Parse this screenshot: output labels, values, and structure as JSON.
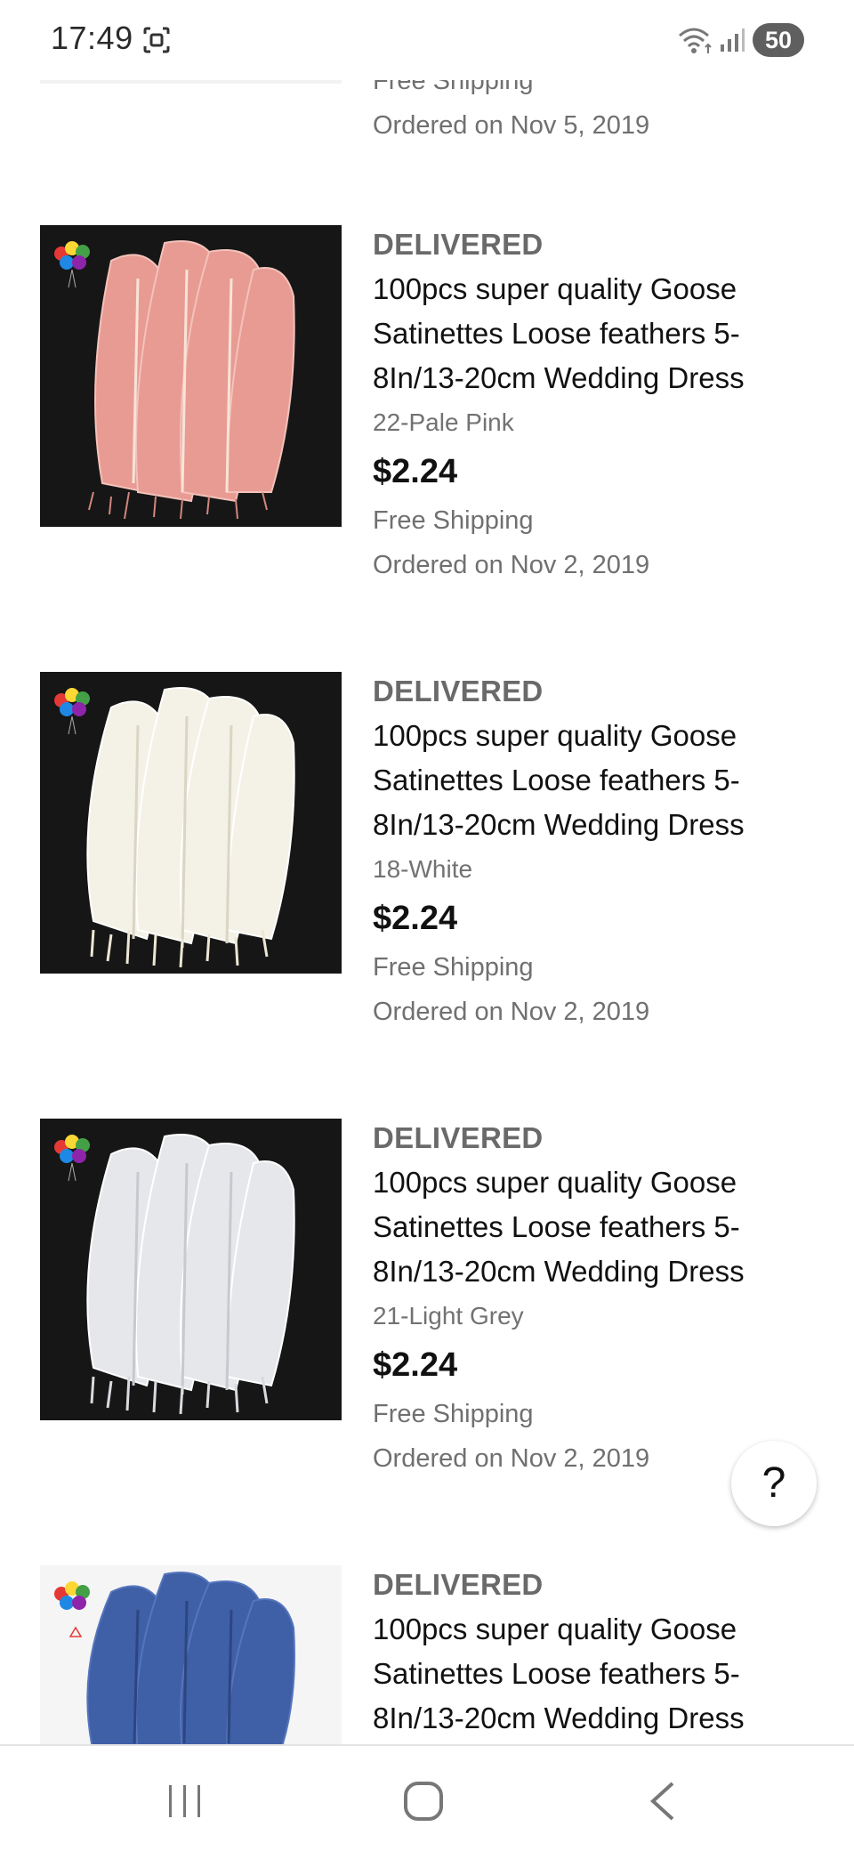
{
  "status_bar": {
    "time": "17:49",
    "battery": "50",
    "icons": [
      "screenshot-icon",
      "wifi-icon",
      "signal-icon"
    ]
  },
  "orders": [
    {
      "shipping": "Free Shipping",
      "ordered": "Ordered on Nov 5, 2019"
    },
    {
      "status": "DELIVERED",
      "title": "100pcs super quality Goose Satinettes Loose feathers 5-8In/13-20cm Wedding Dress",
      "variant": "22-Pale Pink",
      "price": "$2.24",
      "shipping": "Free Shipping",
      "ordered": "Ordered on Nov 2, 2019",
      "feather_color": "#e89b93"
    },
    {
      "status": "DELIVERED",
      "title": "100pcs super quality Goose Satinettes Loose feathers 5-8In/13-20cm Wedding Dress",
      "variant": "18-White",
      "price": "$2.24",
      "shipping": "Free Shipping",
      "ordered": "Ordered on Nov 2, 2019",
      "feather_color": "#f4f1e6"
    },
    {
      "status": "DELIVERED",
      "title": "100pcs super quality Goose Satinettes Loose feathers 5-8In/13-20cm Wedding Dress",
      "variant": "21-Light Grey",
      "price": "$2.24",
      "shipping": "Free Shipping",
      "ordered": "Ordered on Nov 2, 2019",
      "feather_color": "#e6e7ea"
    },
    {
      "status": "DELIVERED",
      "title": "100pcs super quality Goose Satinettes Loose feathers 5-8In/13-20cm Wedding Dress",
      "feather_color": "#3f5fa6"
    }
  ],
  "help_button": {
    "label": "?"
  },
  "nav_bar": {
    "icons": [
      "recents-icon",
      "home-icon",
      "back-icon"
    ]
  }
}
